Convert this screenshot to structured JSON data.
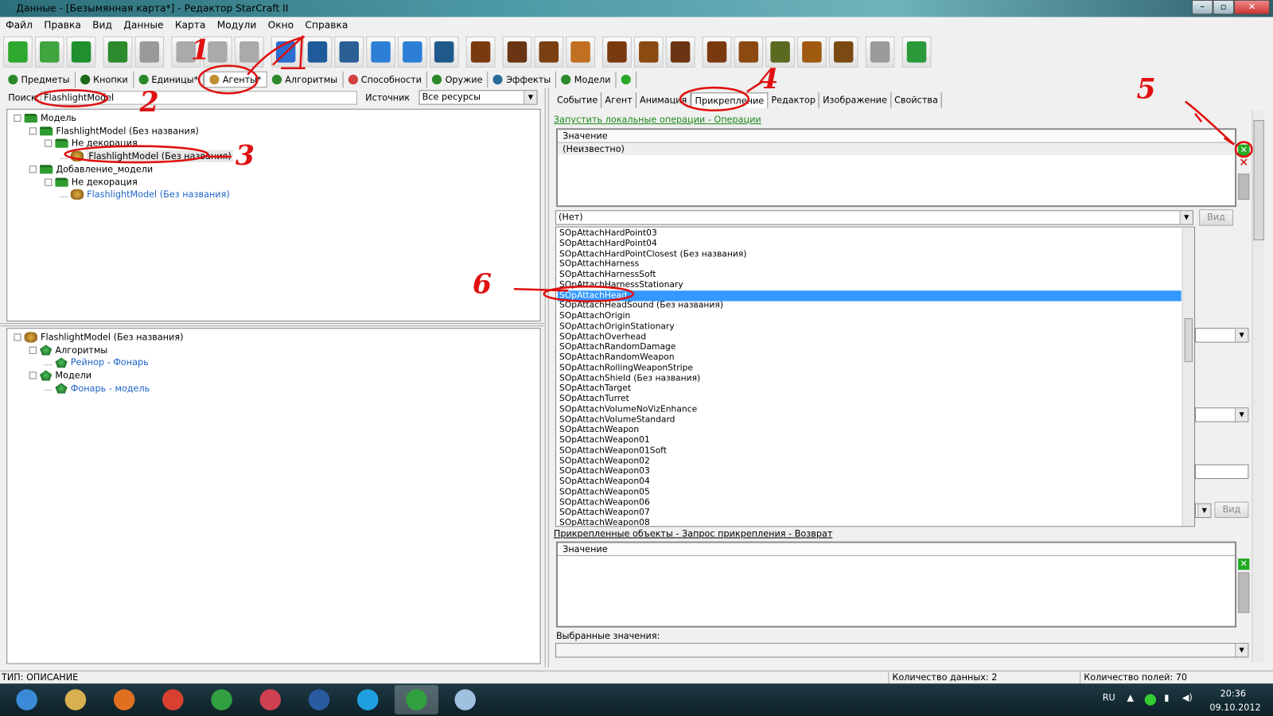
{
  "window": {
    "title": "Данные - [Безымянная карта*] - Редактор StarCraft II",
    "controls": [
      "minimize",
      "maximize",
      "close"
    ]
  },
  "menu": [
    "Файл",
    "Правка",
    "Вид",
    "Данные",
    "Карта",
    "Модули",
    "Окно",
    "Справка"
  ],
  "toolbar": {
    "buttons": [
      {
        "icon": "new-file-icon",
        "color": "#2ea82e"
      },
      {
        "icon": "open-file-icon",
        "color": "#3fa53f"
      },
      {
        "icon": "save-icon",
        "color": "#1f8f2f"
      },
      {
        "icon": "undo-icon",
        "color": "#2b8a2b"
      },
      {
        "icon": "redo-icon",
        "color": "#999999"
      },
      {
        "icon": "cut-icon",
        "color": "#aaaaaa"
      },
      {
        "icon": "copy-icon",
        "color": "#aaaaaa"
      },
      {
        "icon": "paste-icon",
        "color": "#aaaaaa"
      },
      {
        "icon": "terrain-editor-icon",
        "color": "#2a6ccf"
      },
      {
        "icon": "trigger-editor-icon",
        "color": "#1f5a9a"
      },
      {
        "icon": "data-editor-icon",
        "color": "#2a5f95"
      },
      {
        "icon": "text-editor-icon",
        "color": "#2d7fd6"
      },
      {
        "icon": "import-icon",
        "color": "#2d7fd6"
      },
      {
        "icon": "ai-editor-icon",
        "color": "#205a8a"
      },
      {
        "icon": "cutscene-icon",
        "color": "#7a3a10"
      },
      {
        "icon": "list-icon",
        "color": "#6a3512"
      },
      {
        "icon": "unit-tree-icon",
        "color": "#7a4012"
      },
      {
        "icon": "effect-icon",
        "color": "#c07020"
      },
      {
        "icon": "book-icon",
        "color": "#7a3a10"
      },
      {
        "icon": "table-icon",
        "color": "#8a4a12"
      },
      {
        "icon": "outline-icon",
        "color": "#6a3512"
      },
      {
        "icon": "book2-icon",
        "color": "#7a3a10"
      },
      {
        "icon": "grid-icon",
        "color": "#8a4a12"
      },
      {
        "icon": "list2-icon",
        "color": "#5a6a20"
      },
      {
        "icon": "export-icon",
        "color": "#a05a10"
      },
      {
        "icon": "table2-icon",
        "color": "#7a4a12"
      },
      {
        "icon": "test-map-icon",
        "color": "#9a9a9a"
      },
      {
        "icon": "sc2-run-icon",
        "color": "#2a9a3a"
      }
    ]
  },
  "data_tabs": [
    {
      "label": "Предметы",
      "color": "#2a8a2a"
    },
    {
      "label": "Кнопки",
      "color": "#1a6a1a"
    },
    {
      "label": "Единицы*",
      "color": "#2a8a2a"
    },
    {
      "label": "Агенты*",
      "color": "#c09030"
    },
    {
      "label": "Алгоритмы",
      "color": "#2a8a2a"
    },
    {
      "label": "Способности",
      "color": "#d04040"
    },
    {
      "label": "Оружие",
      "color": "#2a8a2a"
    },
    {
      "label": "Эффекты",
      "color": "#2a6a9a"
    },
    {
      "label": "Модели",
      "color": "#2a8a2a"
    },
    {
      "label": "",
      "color": "#2aa82a"
    }
  ],
  "search": {
    "label": "Поиск:",
    "value": "FlashlightModel",
    "source_label": "Источник",
    "source_value": "Все ресурсы"
  },
  "object_tree": [
    {
      "label": "Модель",
      "level": 0,
      "icon": "folder"
    },
    {
      "label": "FlashlightModel (Без названия)",
      "level": 1,
      "icon": "folder"
    },
    {
      "label": "Не декорация",
      "level": 2,
      "icon": "folder"
    },
    {
      "label": "FlashlightModel (Без названия)",
      "level": 3,
      "icon": "agent",
      "selected": true
    },
    {
      "label": "Добавление_модели",
      "level": 1,
      "icon": "folder"
    },
    {
      "label": "Не декорация",
      "level": 2,
      "icon": "folder"
    },
    {
      "label": "FlashlightModel (Без названия)",
      "level": 3,
      "icon": "agent",
      "link": true
    }
  ],
  "dependency_tree": [
    {
      "label": "FlashlightModel (Без названия)",
      "level": 0,
      "icon": "agent"
    },
    {
      "label": "Алгоритмы",
      "level": 1,
      "icon": "leaf"
    },
    {
      "label": "Рейнор - Фонарь",
      "level": 2,
      "icon": "leaf",
      "link": true
    },
    {
      "label": "Модели",
      "level": 1,
      "icon": "leaf"
    },
    {
      "label": "Фонарь - модель",
      "level": 2,
      "icon": "leaf",
      "link": true
    }
  ],
  "detail_tabs": [
    "Событие",
    "Агент",
    "Анимация",
    "Прикрепление",
    "Редактор",
    "Изображение",
    "Свойства"
  ],
  "detail_active_tab": 3,
  "section1": {
    "link": "Запустить локальные операции - Операции",
    "column": "Значение",
    "rows": [
      "(Неизвестно)"
    ],
    "dropdown": "(Нет)",
    "view_button": "Вид"
  },
  "attach_list": {
    "selected": 6,
    "items": [
      "SOpAttachHardPoint03",
      "SOpAttachHardPoint04",
      "SOpAttachHardPointClosest (Без названия)",
      "SOpAttachHarness",
      "SOpAttachHarnessSoft",
      "SOpAttachHarnessStationary",
      "SOpAttachHead",
      "SOpAttachHeadSound (Без названия)",
      "SOpAttachOrigin",
      "SOpAttachOriginStationary",
      "SOpAttachOverhead",
      "SOpAttachRandomDamage",
      "SOpAttachRandomWeapon",
      "SOpAttachRollingWeaponStripe",
      "SOpAttachShield (Без названия)",
      "SOpAttachTarget",
      "SOpAttachTurret",
      "SOpAttachVolumeNoVizEnhance",
      "SOpAttachVolumeStandard",
      "SOpAttachWeapon",
      "SOpAttachWeapon01",
      "SOpAttachWeapon01Soft",
      "SOpAttachWeapon02",
      "SOpAttachWeapon03",
      "SOpAttachWeapon04",
      "SOpAttachWeapon05",
      "SOpAttachWeapon06",
      "SOpAttachWeapon07",
      "SOpAttachWeapon08"
    ]
  },
  "section2": {
    "link": "Прикрепленные объекты - Запрос прикрепления - Возврат",
    "column": "Значение",
    "selected_label": "Выбранные значения:",
    "view_button": "Вид"
  },
  "status": {
    "type": "ТИП: ОПИСАНИЕ",
    "data_count": "Количество данных: 2",
    "field_count": "Количество полей: 70"
  },
  "taskbar": {
    "apps": [
      {
        "icon": "start-icon",
        "color": "#3a8ad8"
      },
      {
        "icon": "explorer-icon",
        "color": "#d8b050"
      },
      {
        "icon": "media-player-icon",
        "color": "#e07020"
      },
      {
        "icon": "chrome-icon",
        "color": "#d84030"
      },
      {
        "icon": "sc2-editor-icon",
        "color": "#30a040"
      },
      {
        "icon": "app-icon",
        "color": "#d04050"
      },
      {
        "icon": "photoshop-icon",
        "color": "#2a5aa0"
      },
      {
        "icon": "skype-icon",
        "color": "#20a0e0"
      },
      {
        "icon": "sc2-editor-active-icon",
        "color": "#30a040"
      },
      {
        "icon": "paint-icon",
        "color": "#a0c0e0"
      }
    ],
    "lang": "RU",
    "time": "20:36",
    "date": "09.10.2012"
  },
  "annotations": [
    "1",
    "2",
    "3",
    "4",
    "5",
    "6"
  ]
}
